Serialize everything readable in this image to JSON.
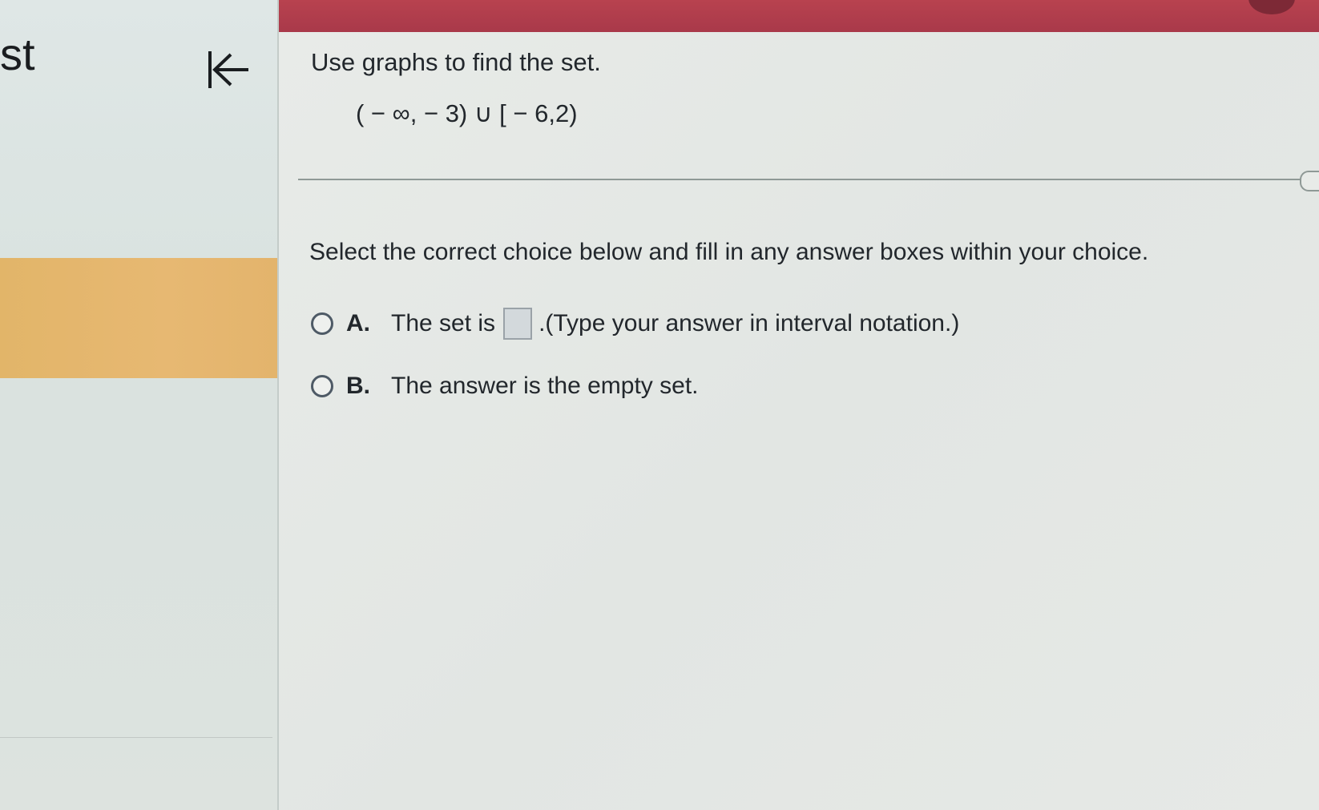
{
  "sidebar": {
    "fragment_text": "st",
    "collapse_icon": "collapse-left-icon"
  },
  "question": {
    "instruction": "Use graphs to find the set.",
    "expression": "( − ∞, − 3) ∪ [ − 6,2)"
  },
  "prompt": "Select the correct choice below and fill in any answer boxes within your choice.",
  "choices": [
    {
      "letter": "A.",
      "before_box": "The set is",
      "after_box": ".(Type your answer in interval notation.)"
    },
    {
      "letter": "B.",
      "text": "The answer is the empty set."
    }
  ],
  "colors": {
    "topbar": "#b8424f",
    "sidebar_highlight": "#e2b569",
    "radio_border": "#4e5a66"
  }
}
